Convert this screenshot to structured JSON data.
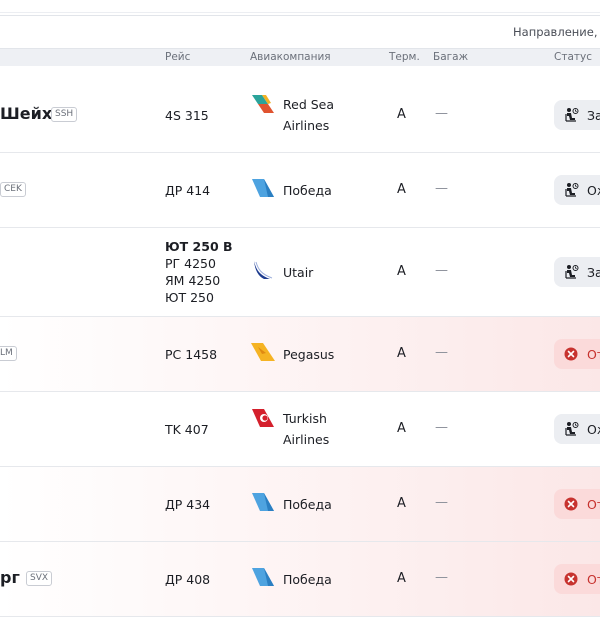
{
  "search": {
    "placeholder": "Направление, но"
  },
  "columns": {
    "flight": "Рейс",
    "airline": "Авиакомпания",
    "terminal": "Терм.",
    "baggage": "Багаж",
    "status": "Статус"
  },
  "rows": [
    {
      "destination": "Шейх",
      "iata": "SSH",
      "flights": [
        "4S 315"
      ],
      "airline_lines": [
        "Red Sea",
        "Airlines"
      ],
      "logo": "red-sea-airlines-logo",
      "terminal": "A",
      "baggage": "—",
      "status_label": "За",
      "status_kind": "waiting"
    },
    {
      "destination": "",
      "iata": "CEK",
      "flights": [
        "ДР 414"
      ],
      "airline_lines": [
        "Победа"
      ],
      "logo": "pobeda-logo",
      "terminal": "A",
      "baggage": "—",
      "status_label": "Ож",
      "status_kind": "waiting"
    },
    {
      "destination": "",
      "iata": "",
      "flights": [
        "ЮТ 250 В",
        "РГ 4250",
        "ЯМ 4250",
        "ЮТ 250"
      ],
      "airline_lines": [
        "Utair"
      ],
      "logo": "utair-logo",
      "terminal": "A",
      "baggage": "—",
      "status_label": "За",
      "status_kind": "waiting"
    },
    {
      "destination": "",
      "iata": "LM",
      "flights": [
        "PC 1458"
      ],
      "airline_lines": [
        "Pegasus"
      ],
      "logo": "pegasus-logo",
      "terminal": "A",
      "baggage": "—",
      "status_label": "От",
      "status_kind": "cancelled"
    },
    {
      "destination": "",
      "iata": "",
      "flights": [
        "TK 407"
      ],
      "airline_lines": [
        "Turkish",
        "Airlines"
      ],
      "logo": "turkish-airlines-logo",
      "terminal": "A",
      "baggage": "—",
      "status_label": "Ож",
      "status_kind": "waiting"
    },
    {
      "destination": "",
      "iata": "",
      "flights": [
        "ДР 434"
      ],
      "airline_lines": [
        "Победа"
      ],
      "logo": "pobeda-logo",
      "terminal": "A",
      "baggage": "—",
      "status_label": "От",
      "status_kind": "cancelled"
    },
    {
      "destination": "рг",
      "iata": "SVX",
      "flights": [
        "ДР 408"
      ],
      "airline_lines": [
        "Победа"
      ],
      "logo": "pobeda-logo",
      "terminal": "A",
      "baggage": "—",
      "status_label": "От",
      "status_kind": "cancelled"
    }
  ],
  "colors": {
    "cancel_bg": "#fbdada",
    "cancel_text": "#c7332f",
    "waiting_bg": "#eceef2",
    "pobeda_blue": "#4ea3e0",
    "pegasus_yellow": "#f5b323",
    "turkish_red": "#d4202c",
    "redsea_green": "#2aa39a",
    "utair_navy": "#1d3b8f"
  }
}
